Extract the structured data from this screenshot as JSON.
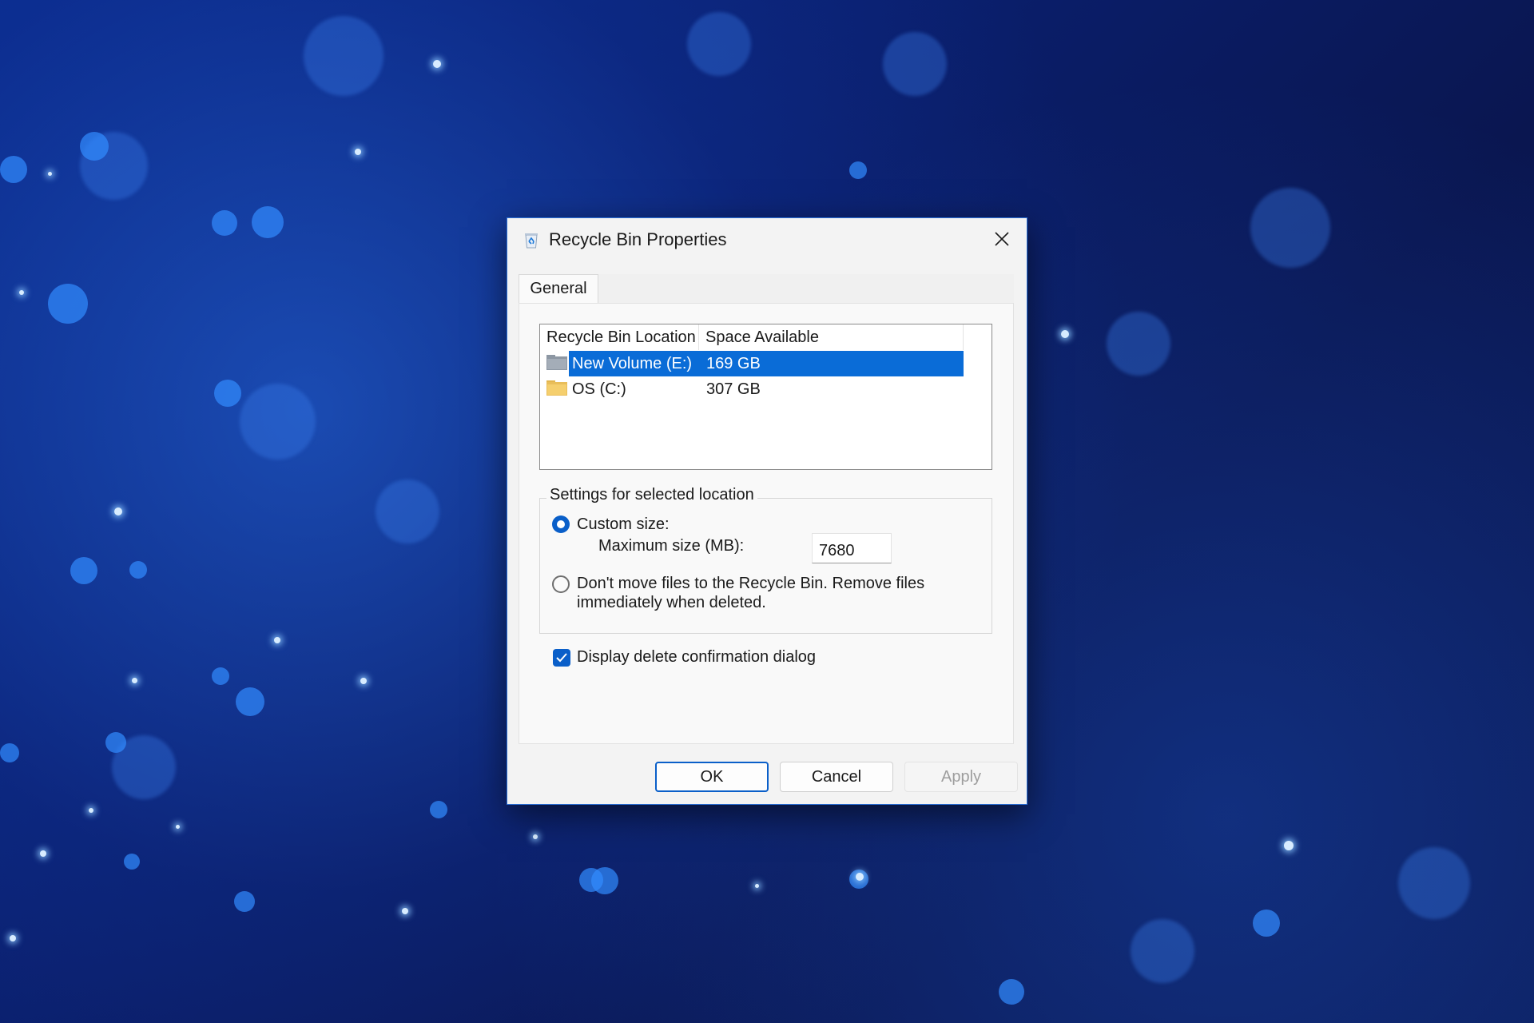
{
  "window": {
    "title": "Recycle Bin Properties",
    "title_icon": "recycle-bin-icon",
    "close_icon": "close-icon"
  },
  "tabs": [
    {
      "label": "General",
      "active": true
    }
  ],
  "location_list": {
    "columns": [
      "Recycle Bin Location",
      "Space Available"
    ],
    "rows": [
      {
        "location": "New Volume (E:)",
        "space": "169 GB",
        "selected": true,
        "icon": "drive-icon"
      },
      {
        "location": "OS (C:)",
        "space": "307 GB",
        "selected": false,
        "icon": "folder-icon"
      }
    ]
  },
  "settings": {
    "group_label": "Settings for selected location",
    "custom_size_label": "Custom size:",
    "custom_size_selected": true,
    "max_size_label": "Maximum size (MB):",
    "max_size_value": "7680",
    "dont_move_label_line1": "Don't move files to the Recycle Bin. Remove files",
    "dont_move_label_line2": "immediately when deleted.",
    "dont_move_selected": false
  },
  "confirm": {
    "label": "Display delete confirmation dialog",
    "checked": true
  },
  "buttons": {
    "ok": "OK",
    "cancel": "Cancel",
    "apply": "Apply"
  },
  "colors": {
    "accent": "#0a5fc9",
    "selection": "#0a6cd7",
    "background_deep": "#0a1650"
  }
}
